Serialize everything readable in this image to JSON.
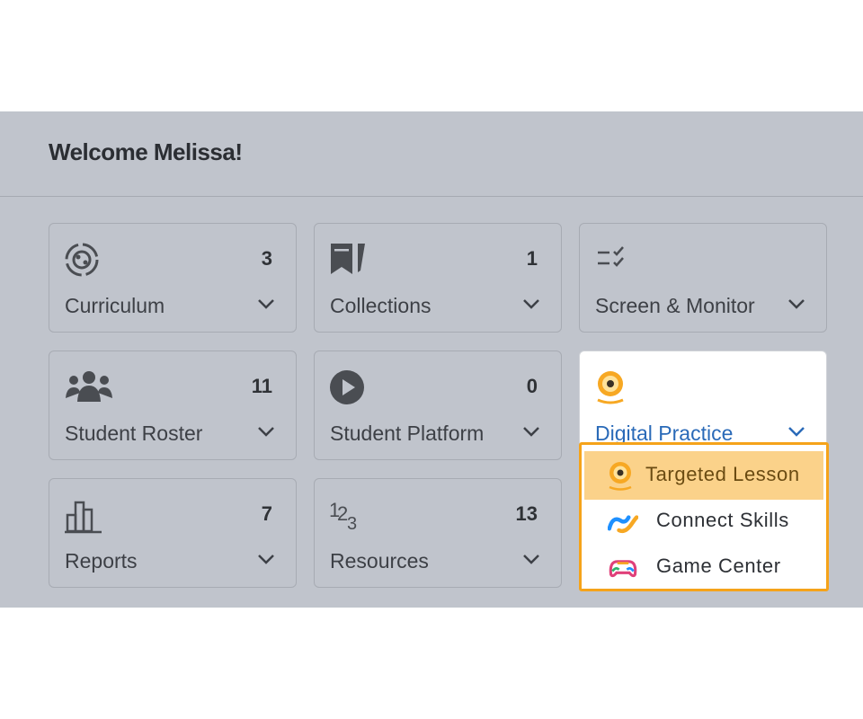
{
  "header": {
    "title": "Welcome Melissa!"
  },
  "cards": [
    {
      "label": "Curriculum",
      "count": "3",
      "icon": "curriculum-icon"
    },
    {
      "label": "Collections",
      "count": "1",
      "icon": "collections-icon"
    },
    {
      "label": "Screen & Monitor",
      "count": "",
      "icon": "checklist-icon"
    },
    {
      "label": "Student Roster",
      "count": "11",
      "icon": "people-icon"
    },
    {
      "label": "Student Platform",
      "count": "0",
      "icon": "play-icon"
    },
    {
      "label": "Digital Practice",
      "count": "",
      "icon": "target-icon"
    },
    {
      "label": "Reports",
      "count": "7",
      "icon": "bar-chart-icon"
    },
    {
      "label": "Resources",
      "count": "13",
      "icon": "numbers-icon"
    }
  ],
  "dropdown": {
    "items": [
      {
        "label": "Targeted Lesson",
        "icon": "target-icon"
      },
      {
        "label": "Connect Skills",
        "icon": "connect-skills-icon"
      },
      {
        "label": "Game Center",
        "icon": "game-controller-icon"
      }
    ]
  },
  "colors": {
    "panel_bg": "#c0c4cc",
    "accent_orange": "#f5a31a",
    "highlight": "#fbd28a",
    "link_blue": "#2a6ab8"
  }
}
